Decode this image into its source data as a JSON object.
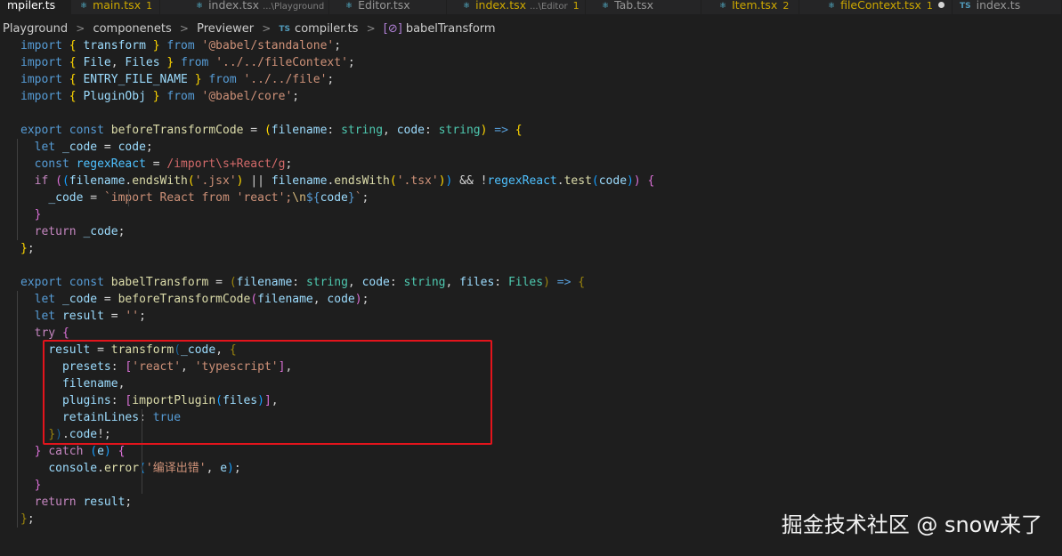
{
  "tabs": [
    {
      "label": "mpiler.ts",
      "icon": "",
      "sub": "",
      "badge": "",
      "dot": false,
      "active": true
    },
    {
      "label": "main.tsx",
      "icon": "⚛",
      "sub": "",
      "badge": "1",
      "dot": false,
      "active": false
    },
    {
      "label": "index.tsx",
      "icon": "⚛",
      "sub": "...\\Playground",
      "badge": "",
      "dot": false,
      "active": false
    },
    {
      "label": "Editor.tsx",
      "icon": "⚛",
      "sub": "",
      "badge": "",
      "dot": false,
      "active": false
    },
    {
      "label": "index.tsx",
      "icon": "⚛",
      "sub": "...\\Editor",
      "badge": "1",
      "dot": false,
      "active": false
    },
    {
      "label": "Tab.tsx",
      "icon": "⚛",
      "sub": "",
      "badge": "",
      "dot": false,
      "active": false
    },
    {
      "label": "Item.tsx",
      "icon": "⚛",
      "sub": "",
      "badge": "2",
      "dot": false,
      "active": false
    },
    {
      "label": "fileContext.tsx",
      "icon": "⚛",
      "sub": "",
      "badge": "1",
      "dot": true,
      "active": false
    },
    {
      "label": "index.ts",
      "icon": "TS",
      "sub": "",
      "badge": "",
      "dot": false,
      "active": false
    }
  ],
  "breadcrumb": {
    "items": [
      "Playground",
      "componenets",
      "Previewer"
    ],
    "file_badge": "TS",
    "file": "compiler.ts",
    "symbol": "babelTransform"
  },
  "colors": {
    "background": "#1e1e1e",
    "highlight_border": "#e3141c"
  },
  "code_lines": [
    [
      [
        "kw",
        "import"
      ],
      [
        "p",
        " "
      ],
      [
        "br1",
        "{"
      ],
      [
        "p",
        " "
      ],
      [
        "var",
        "transform"
      ],
      [
        "p",
        " "
      ],
      [
        "br1",
        "}"
      ],
      [
        "p",
        " "
      ],
      [
        "kw",
        "from"
      ],
      [
        "p",
        " "
      ],
      [
        "str",
        "'@babel/standalone'"
      ],
      [
        "p",
        ";"
      ]
    ],
    [
      [
        "kw",
        "import"
      ],
      [
        "p",
        " "
      ],
      [
        "br1",
        "{"
      ],
      [
        "p",
        " "
      ],
      [
        "var",
        "File"
      ],
      [
        "p",
        ", "
      ],
      [
        "var",
        "Files"
      ],
      [
        "p",
        " "
      ],
      [
        "br1",
        "}"
      ],
      [
        "p",
        " "
      ],
      [
        "kw",
        "from"
      ],
      [
        "p",
        " "
      ],
      [
        "str",
        "'../../fileContext'"
      ],
      [
        "p",
        ";"
      ]
    ],
    [
      [
        "kw",
        "import"
      ],
      [
        "p",
        " "
      ],
      [
        "br1",
        "{"
      ],
      [
        "p",
        " "
      ],
      [
        "var",
        "ENTRY_FILE_NAME"
      ],
      [
        "p",
        " "
      ],
      [
        "br1",
        "}"
      ],
      [
        "p",
        " "
      ],
      [
        "kw",
        "from"
      ],
      [
        "p",
        " "
      ],
      [
        "str",
        "'../../file'"
      ],
      [
        "p",
        ";"
      ]
    ],
    [
      [
        "kw",
        "import"
      ],
      [
        "p",
        " "
      ],
      [
        "br1",
        "{"
      ],
      [
        "p",
        " "
      ],
      [
        "var",
        "PluginObj"
      ],
      [
        "p",
        " "
      ],
      [
        "br1",
        "}"
      ],
      [
        "p",
        " "
      ],
      [
        "kw",
        "from"
      ],
      [
        "p",
        " "
      ],
      [
        "str",
        "'@babel/core'"
      ],
      [
        "p",
        ";"
      ]
    ],
    [],
    [
      [
        "kw",
        "export"
      ],
      [
        "p",
        " "
      ],
      [
        "kw",
        "const"
      ],
      [
        "p",
        " "
      ],
      [
        "fn",
        "beforeTransformCode"
      ],
      [
        "p",
        " = "
      ],
      [
        "br1",
        "("
      ],
      [
        "var",
        "filename"
      ],
      [
        "p",
        ": "
      ],
      [
        "type",
        "string"
      ],
      [
        "p",
        ", "
      ],
      [
        "var",
        "code"
      ],
      [
        "p",
        ": "
      ],
      [
        "type",
        "string"
      ],
      [
        "br1",
        ")"
      ],
      [
        "p",
        " "
      ],
      [
        "kw",
        "=>"
      ],
      [
        "p",
        " "
      ],
      [
        "br1",
        "{"
      ]
    ],
    [
      [
        "p",
        "  "
      ],
      [
        "kw",
        "let"
      ],
      [
        "p",
        " "
      ],
      [
        "var",
        "_code"
      ],
      [
        "p",
        " = "
      ],
      [
        "var",
        "code"
      ],
      [
        "p",
        ";"
      ]
    ],
    [
      [
        "p",
        "  "
      ],
      [
        "kw",
        "const"
      ],
      [
        "p",
        " "
      ],
      [
        "const",
        "regexReact"
      ],
      [
        "p",
        " = "
      ],
      [
        "regex",
        "/import\\s+React/g"
      ],
      [
        "p",
        ";"
      ]
    ],
    [
      [
        "p",
        "  "
      ],
      [
        "ctl",
        "if"
      ],
      [
        "p",
        " "
      ],
      [
        "br2",
        "("
      ],
      [
        "br3",
        "("
      ],
      [
        "var",
        "filename"
      ],
      [
        "p",
        "."
      ],
      [
        "fn",
        "endsWith"
      ],
      [
        "br1",
        "("
      ],
      [
        "str",
        "'.jsx'"
      ],
      [
        "br1",
        ")"
      ],
      [
        "p",
        " || "
      ],
      [
        "var",
        "filename"
      ],
      [
        "p",
        "."
      ],
      [
        "fn",
        "endsWith"
      ],
      [
        "br1",
        "("
      ],
      [
        "str",
        "'.tsx'"
      ],
      [
        "br1",
        ")"
      ],
      [
        "br3",
        ")"
      ],
      [
        "p",
        " && !"
      ],
      [
        "const",
        "regexReact"
      ],
      [
        "p",
        "."
      ],
      [
        "fn",
        "test"
      ],
      [
        "br3",
        "("
      ],
      [
        "var",
        "code"
      ],
      [
        "br3",
        ")"
      ],
      [
        "br2",
        ")"
      ],
      [
        "p",
        " "
      ],
      [
        "br2",
        "{"
      ]
    ],
    [
      [
        "p",
        "    "
      ],
      [
        "var",
        "_code"
      ],
      [
        "p",
        " = "
      ],
      [
        "str",
        "`import React from 'react';"
      ],
      [
        "esc",
        "\\n"
      ],
      [
        "kw",
        "${"
      ],
      [
        "var",
        "code"
      ],
      [
        "kw",
        "}"
      ],
      [
        "str",
        "`"
      ],
      [
        "p",
        ";"
      ]
    ],
    [
      [
        "p",
        "  "
      ],
      [
        "br2",
        "}"
      ]
    ],
    [
      [
        "p",
        "  "
      ],
      [
        "ctl",
        "return"
      ],
      [
        "p",
        " "
      ],
      [
        "var",
        "_code"
      ],
      [
        "p",
        ";"
      ]
    ],
    [
      [
        "br1",
        "}"
      ],
      [
        "p",
        ";"
      ]
    ],
    [],
    [
      [
        "kw",
        "export"
      ],
      [
        "p",
        " "
      ],
      [
        "kw",
        "const"
      ],
      [
        "p",
        " "
      ],
      [
        "fn",
        "babelTransform"
      ],
      [
        "p",
        " = "
      ],
      [
        "dim1",
        "("
      ],
      [
        "var",
        "filename"
      ],
      [
        "p",
        ": "
      ],
      [
        "type",
        "string"
      ],
      [
        "p",
        ", "
      ],
      [
        "var",
        "code"
      ],
      [
        "p",
        ": "
      ],
      [
        "type",
        "string"
      ],
      [
        "p",
        ", "
      ],
      [
        "var",
        "files"
      ],
      [
        "p",
        ": "
      ],
      [
        "type",
        "Files"
      ],
      [
        "dim1",
        ")"
      ],
      [
        "p",
        " "
      ],
      [
        "kw",
        "=>"
      ],
      [
        "p",
        " "
      ],
      [
        "dim1",
        "{"
      ]
    ],
    [
      [
        "p",
        "  "
      ],
      [
        "kw",
        "let"
      ],
      [
        "p",
        " "
      ],
      [
        "var",
        "_code"
      ],
      [
        "p",
        " = "
      ],
      [
        "fn",
        "beforeTransformCode"
      ],
      [
        "br2",
        "("
      ],
      [
        "var",
        "filename"
      ],
      [
        "p",
        ", "
      ],
      [
        "var",
        "code"
      ],
      [
        "br2",
        ")"
      ],
      [
        "p",
        ";"
      ]
    ],
    [
      [
        "p",
        "  "
      ],
      [
        "kw",
        "let"
      ],
      [
        "p",
        " "
      ],
      [
        "var",
        "result"
      ],
      [
        "p",
        " = "
      ],
      [
        "str",
        "''"
      ],
      [
        "p",
        ";"
      ]
    ],
    [
      [
        "p",
        "  "
      ],
      [
        "ctl",
        "try"
      ],
      [
        "p",
        " "
      ],
      [
        "br2",
        "{"
      ]
    ],
    [
      [
        "p",
        "    "
      ],
      [
        "var",
        "result"
      ],
      [
        "p",
        " = "
      ],
      [
        "fn",
        "transform"
      ],
      [
        "dim3",
        "("
      ],
      [
        "var",
        "_code"
      ],
      [
        "p",
        ", "
      ],
      [
        "dim1",
        "{"
      ]
    ],
    [
      [
        "p",
        "      "
      ],
      [
        "var",
        "presets"
      ],
      [
        "p",
        ": "
      ],
      [
        "br2",
        "["
      ],
      [
        "str",
        "'react'"
      ],
      [
        "p",
        ", "
      ],
      [
        "str",
        "'typescript'"
      ],
      [
        "br2",
        "]"
      ],
      [
        "p",
        ","
      ]
    ],
    [
      [
        "p",
        "      "
      ],
      [
        "var",
        "filename"
      ],
      [
        "p",
        ","
      ]
    ],
    [
      [
        "p",
        "      "
      ],
      [
        "var",
        "plugins"
      ],
      [
        "p",
        ": "
      ],
      [
        "br2",
        "["
      ],
      [
        "fn",
        "importPlugin"
      ],
      [
        "br3",
        "("
      ],
      [
        "var",
        "files"
      ],
      [
        "br3",
        ")"
      ],
      [
        "br2",
        "]"
      ],
      [
        "p",
        ","
      ]
    ],
    [
      [
        "p",
        "      "
      ],
      [
        "var",
        "retainLines"
      ],
      [
        "p",
        ": "
      ],
      [
        "kw",
        "true"
      ]
    ],
    [
      [
        "p",
        "    "
      ],
      [
        "dim1",
        "}"
      ],
      [
        "dim3",
        ")"
      ],
      [
        "p",
        "."
      ],
      [
        "var",
        "code"
      ],
      [
        "p",
        "!;"
      ]
    ],
    [
      [
        "p",
        "  "
      ],
      [
        "br2",
        "}"
      ],
      [
        "p",
        " "
      ],
      [
        "ctl",
        "catch"
      ],
      [
        "p",
        " "
      ],
      [
        "br3",
        "("
      ],
      [
        "var",
        "e"
      ],
      [
        "br3",
        ")"
      ],
      [
        "p",
        " "
      ],
      [
        "br2",
        "{"
      ]
    ],
    [
      [
        "p",
        "    "
      ],
      [
        "var",
        "console"
      ],
      [
        "p",
        "."
      ],
      [
        "fn",
        "error"
      ],
      [
        "br3",
        "("
      ],
      [
        "str",
        "'编译出错'"
      ],
      [
        "p",
        ", "
      ],
      [
        "var",
        "e"
      ],
      [
        "br3",
        ")"
      ],
      [
        "p",
        ";"
      ]
    ],
    [
      [
        "p",
        "  "
      ],
      [
        "br2",
        "}"
      ]
    ],
    [
      [
        "p",
        "  "
      ],
      [
        "ctl",
        "return"
      ],
      [
        "p",
        " "
      ],
      [
        "var",
        "result"
      ],
      [
        "p",
        ";"
      ]
    ],
    [
      [
        "dim1",
        "}"
      ],
      [
        "p",
        ";"
      ]
    ]
  ],
  "watermark": "掘金技术社区 @ snow来了"
}
